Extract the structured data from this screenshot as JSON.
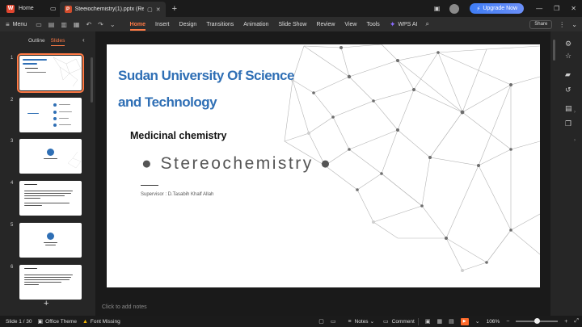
{
  "titlebar": {
    "home_tab": "Home",
    "doc_tab": "Steeiochemistry(1).pptx (Read",
    "upgrade": "Upgrade Now"
  },
  "ribbon": {
    "menu": "Menu",
    "tabs": [
      "Home",
      "Insert",
      "Design",
      "Transitions",
      "Animation",
      "Slide Show",
      "Review",
      "View",
      "Tools"
    ],
    "ai": "WPS AI",
    "share": "Share"
  },
  "leftpanel": {
    "tabs": [
      "Outline",
      "Slides"
    ],
    "active_tab": "Slides",
    "slide_numbers": [
      "1",
      "2",
      "3",
      "4",
      "5",
      "6"
    ]
  },
  "slide": {
    "title_line1": "Sudan University Of Science",
    "title_line2": "and Technology",
    "subtitle": "Medicinal chemistry",
    "main": "● Stereochemistry ●",
    "supervisor": "Supervisor : D.Tasabih Khalf Allah",
    "title_color": "#2f6fb5"
  },
  "notes_placeholder": "Click to add notes",
  "statusbar": {
    "slide_info": "Slide 1 / 30",
    "theme": "Office Theme",
    "font_missing": "Font Missing",
    "notes": "Notes",
    "comment": "Comment",
    "zoom": "106%",
    "zoom_fraction": 0.5
  },
  "icons": [
    "wps-logo-icon",
    "presentation-icon",
    "close-icon",
    "plus-icon",
    "menu-icon",
    "search-icon",
    "settings-icon",
    "star-icon",
    "history-icon",
    "theme-icon",
    "warning-icon",
    "play-icon"
  ]
}
